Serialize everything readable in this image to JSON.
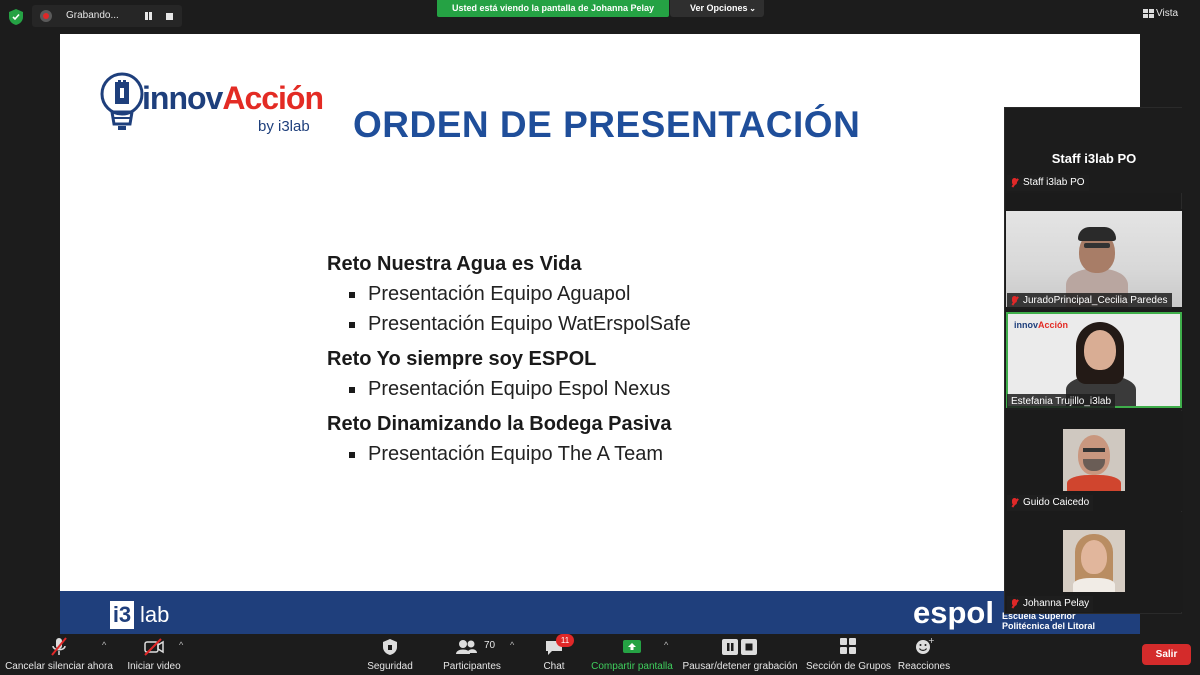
{
  "top_bar": {
    "recording_label": "Grabando...",
    "share_banner": "Usted está viendo la pantalla de Johanna Pelay",
    "view_options_label": "Ver Opciones",
    "view_label": "Vista"
  },
  "slide": {
    "logo_part1": "innov",
    "logo_part2": "Acción",
    "logo_sub": "by i3lab",
    "title": "ORDEN DE PRESENTACIÓN",
    "challenges": [
      {
        "name": "Reto Nuestra Agua es Vida",
        "items": [
          "Presentación Equipo Aguapol",
          "Presentación Equipo WatErspolSafe"
        ]
      },
      {
        "name": "Reto Yo siempre soy ESPOL",
        "items": [
          "Presentación Equipo Espol Nexus"
        ]
      },
      {
        "name": "Reto Dinamizando la Bodega Pasiva",
        "items": [
          "Presentación Equipo The A Team"
        ]
      }
    ],
    "footer_i3": "i3",
    "footer_lab": "lab",
    "footer_espol": "espol",
    "footer_espol_sub1": "Escuela Superior",
    "footer_espol_sub2": "Politécnica del Litoral"
  },
  "panel": {
    "title": "Staff i3lab PO",
    "participants": [
      {
        "name": "Staff i3lab PO",
        "muted": true
      },
      {
        "name": "JuradoPrincipal_Cecilia Paredes",
        "muted": true
      },
      {
        "name": "Estefania Trujillo_i3lab",
        "muted": false
      },
      {
        "name": "Guido Caicedo",
        "muted": true
      },
      {
        "name": "Johanna Pelay",
        "muted": true
      }
    ]
  },
  "toolbar": {
    "unmute_label": "Cancelar silenciar ahora",
    "video_label": "Iniciar video",
    "security_label": "Seguridad",
    "participants_label": "Participantes",
    "participants_count": "70",
    "chat_label": "Chat",
    "chat_badge": "11",
    "share_label": "Compartir pantalla",
    "record_label": "Pausar/detener grabación",
    "breakout_label": "Sección de Grupos",
    "reactions_label": "Reacciones",
    "leave_label": "Salir"
  },
  "colors": {
    "share_green": "#25a244",
    "slide_blue": "#1f4e9a",
    "logo_red": "#e32b24",
    "leave_red": "#d42b2b"
  }
}
